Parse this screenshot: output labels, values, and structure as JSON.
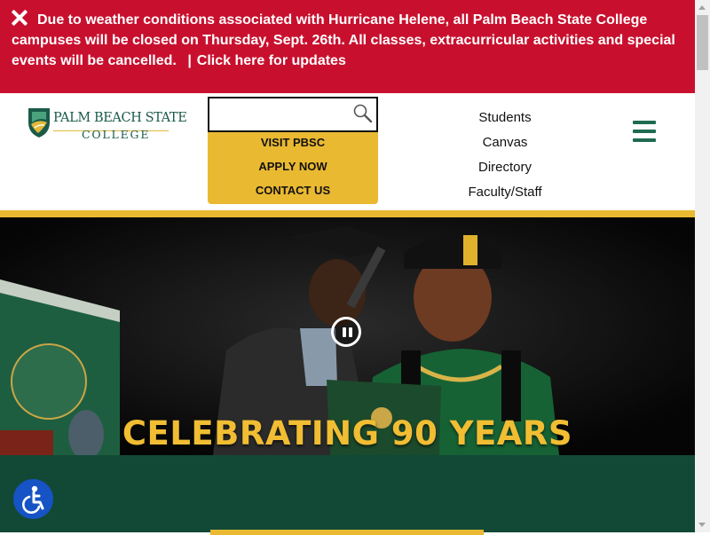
{
  "alert": {
    "message": "Due to weather conditions associated with Hurricane Helene, all Palm Beach State College campuses will be closed on Thursday, Sept. 26th. All classes, extracurricular activities and special events will be cancelled.",
    "separator": "|",
    "link": "Click here for updates"
  },
  "logo": {
    "name": "PALM BEACH STATE",
    "sub": "COLLEGE"
  },
  "search": {
    "placeholder": "",
    "value": ""
  },
  "quick_links": [
    {
      "label": "VISIT PBSC"
    },
    {
      "label": "APPLY NOW"
    },
    {
      "label": "CONTACT US"
    }
  ],
  "nav": [
    {
      "label": "Students"
    },
    {
      "label": "Canvas"
    },
    {
      "label": "Directory"
    },
    {
      "label": "Faculty/Staff"
    }
  ],
  "hero": {
    "title": "CELEBRATING 90 YEARS"
  },
  "colors": {
    "alert_red": "#c8102e",
    "brand_green": "#114936",
    "accent_gold": "#eab932",
    "accessibility_blue": "#1653c4"
  },
  "icons": {
    "close": "close-icon",
    "search": "search-icon",
    "menu": "hamburger-menu-icon",
    "pause": "pause-icon",
    "accessibility": "accessibility-icon"
  }
}
